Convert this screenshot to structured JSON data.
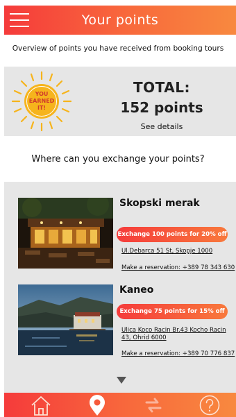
{
  "header": {
    "title": "Your points",
    "menu_icon": "hamburger-menu-icon"
  },
  "overview_text": "Overview of points you have  received from booking tours",
  "total": {
    "badge_line1": "YOU",
    "badge_line2": "EARNED",
    "badge_line3": "IT!",
    "label": "TOTAL:",
    "points": "152 points",
    "details_link": "See details"
  },
  "question": "Where can you exchange your points?",
  "venues": [
    {
      "name": "Skopski merak",
      "offer": "Exchange 100 points for 20% off",
      "address": "Ul.Debarca 51 St, Skopje 1000",
      "reservation": "Make a reservation: +389 78 343 630"
    },
    {
      "name": "Kaneo",
      "offer": "Exchange 75 points for 15% off",
      "address_line1": "Ulica  Koco  Racin  Br.43  Kocho  Racin",
      "address_line2": "43, Ohrid 6000",
      "reservation": "Make a reservation: +389 70 776 837"
    }
  ],
  "nav": {
    "items": [
      "home-icon",
      "location-pin-icon",
      "exchange-icon",
      "help-icon"
    ]
  },
  "colors": {
    "accent_start": "#f53b3b",
    "accent_end": "#f8893f",
    "panel_gray": "#e6e6e6",
    "sun_yellow": "#f6b41c"
  }
}
